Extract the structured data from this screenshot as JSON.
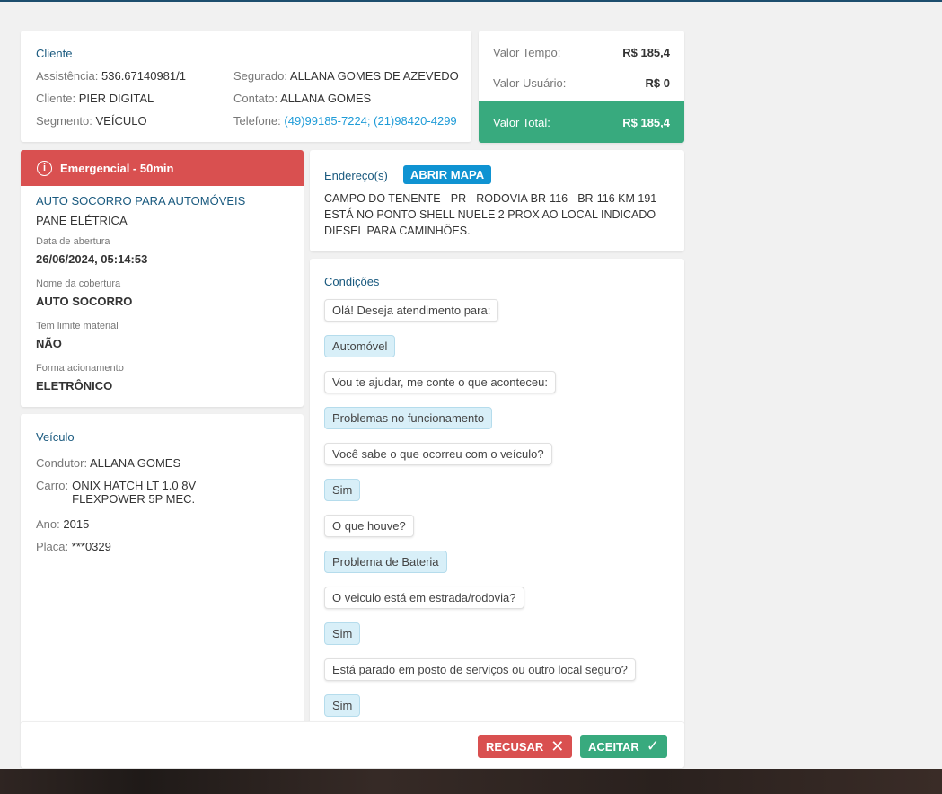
{
  "cliente": {
    "title": "Cliente",
    "left": [
      {
        "label": "Assistência:",
        "value": "536.67140981/1"
      },
      {
        "label": "Cliente:",
        "value": "PIER DIGITAL"
      },
      {
        "label": "Segmento:",
        "value": "VEÍCULO"
      }
    ],
    "right": [
      {
        "label": "Segurado:",
        "value": "ALLANA GOMES DE AZEVEDO"
      },
      {
        "label": "Contato:",
        "value": "ALLANA GOMES"
      },
      {
        "label": "Telefone:",
        "value": "(49)99185-7224; (21)98420-4299"
      }
    ]
  },
  "valores": {
    "tempo_label": "Valor Tempo:",
    "tempo": "R$ 185,4",
    "usuario_label": "Valor Usuário:",
    "usuario": "R$ 0",
    "total_label": "Valor Total:",
    "total": "R$ 185,4"
  },
  "servico": {
    "badge": "Emergencial - 50min",
    "tipo": "AUTO SOCORRO PARA AUTOMÓVEIS",
    "motivo": "PANE ELÉTRICA",
    "fields": [
      {
        "label": "Data de abertura",
        "value": "26/06/2024, 05:14:53"
      },
      {
        "label": "Nome da cobertura",
        "value": "AUTO SOCORRO"
      },
      {
        "label": "Tem limite material",
        "value": "NÃO"
      },
      {
        "label": "Forma acionamento",
        "value": "ELETRÔNICO"
      }
    ]
  },
  "veiculo": {
    "title": "Veículo",
    "fields": [
      {
        "label": "Condutor:",
        "value": "ALLANA GOMES"
      },
      {
        "label": "Carro:",
        "value": "ONIX HATCH LT 1.0 8V FLEXPOWER 5P MEC."
      },
      {
        "label": "Ano:",
        "value": "2015"
      },
      {
        "label": "Placa:",
        "value": "***0329"
      }
    ]
  },
  "endereco": {
    "title": "Endereço(s)",
    "map_button": "ABRIR MAPA",
    "lines": [
      "CAMPO DO TENENTE - PR - RODOVIA BR-116 - BR-116 KM 191",
      "ESTÁ NO PONTO SHELL NUELE 2 PROX AO LOCAL INDICADO",
      "DIESEL PARA CAMINHÕES."
    ]
  },
  "condicoes": {
    "title": "Condições",
    "messages": [
      {
        "type": "q",
        "text": "Olá! Deseja atendimento para:"
      },
      {
        "type": "a",
        "text": "Automóvel"
      },
      {
        "type": "q",
        "text": "Vou te ajudar, me conte o que aconteceu:"
      },
      {
        "type": "a",
        "text": "Problemas no funcionamento"
      },
      {
        "type": "q",
        "text": "Você sabe o que ocorreu com o veículo?"
      },
      {
        "type": "a",
        "text": "Sim"
      },
      {
        "type": "q",
        "text": "O que houve?"
      },
      {
        "type": "a",
        "text": "Problema de Bateria"
      },
      {
        "type": "q",
        "text": "O veiculo está em estrada/rodovia?"
      },
      {
        "type": "a",
        "text": "Sim"
      },
      {
        "type": "q",
        "text": "Está parado em posto de serviços ou outro local seguro?"
      },
      {
        "type": "a",
        "text": "Sim"
      }
    ]
  },
  "actions": {
    "recusar": "RECUSAR",
    "aceitar": "ACEITAR"
  },
  "colors": {
    "green": "#38aa7e",
    "red": "#d95050",
    "blue": "#1e9bd7"
  }
}
